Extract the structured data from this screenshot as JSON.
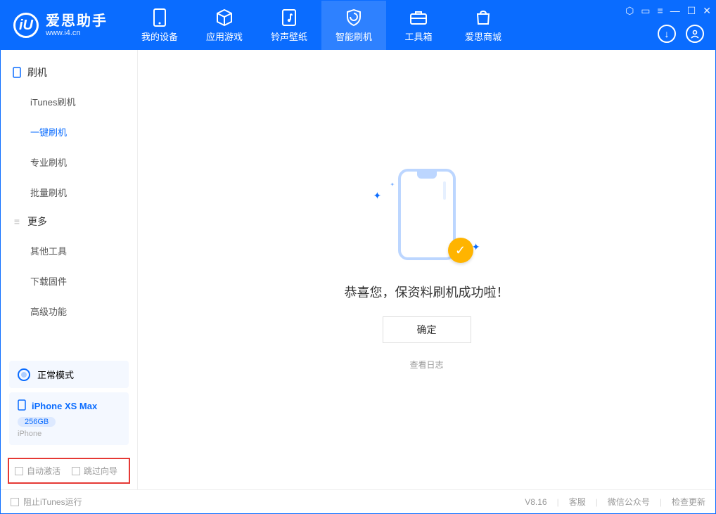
{
  "app": {
    "name": "爱思助手",
    "site": "www.i4.cn",
    "logo_letter": "iU"
  },
  "nav": {
    "items": [
      {
        "label": "我的设备",
        "icon": "device"
      },
      {
        "label": "应用游戏",
        "icon": "cube"
      },
      {
        "label": "铃声壁纸",
        "icon": "music"
      },
      {
        "label": "智能刷机",
        "icon": "shield"
      },
      {
        "label": "工具箱",
        "icon": "toolbox"
      },
      {
        "label": "爱思商城",
        "icon": "bag"
      }
    ],
    "active_index": 3
  },
  "sidebar": {
    "groups": [
      {
        "title": "刷机",
        "icon": "phone",
        "items": [
          "iTunes刷机",
          "一键刷机",
          "专业刷机",
          "批量刷机"
        ],
        "active_index": 1
      },
      {
        "title": "更多",
        "icon": "menu",
        "items": [
          "其他工具",
          "下载固件",
          "高级功能"
        ],
        "active_index": -1
      }
    ],
    "status": {
      "label": "正常模式"
    },
    "device": {
      "name": "iPhone XS Max",
      "storage": "256GB",
      "type": "iPhone"
    },
    "checks": {
      "auto_activate": "自动激活",
      "skip_guide": "跳过向导"
    }
  },
  "main": {
    "success_text": "恭喜您，保资料刷机成功啦！",
    "ok_label": "确定",
    "log_link": "查看日志"
  },
  "footer": {
    "block_itunes": "阻止iTunes运行",
    "version": "V8.16",
    "links": [
      "客服",
      "微信公众号",
      "检查更新"
    ]
  }
}
